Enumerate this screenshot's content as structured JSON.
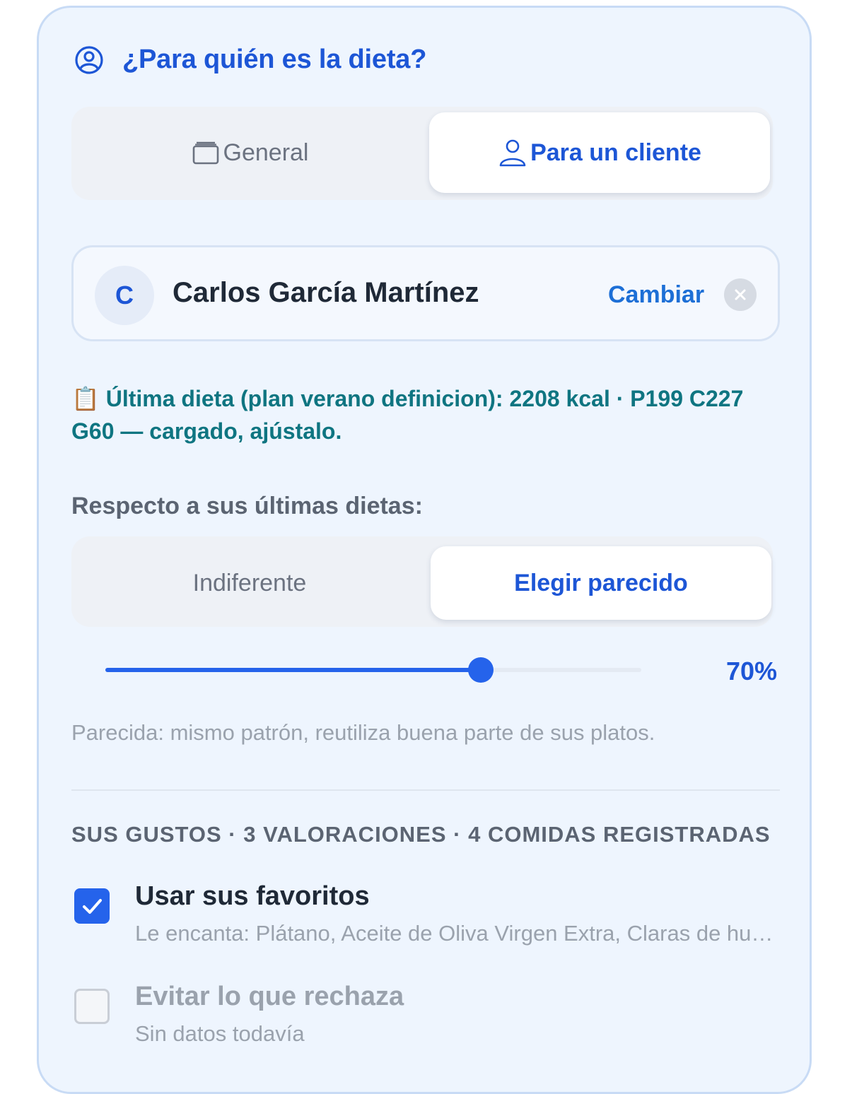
{
  "header": {
    "title": "¿Para quién es la dieta?",
    "icon": "user-circle-icon"
  },
  "target_selector": {
    "options": [
      {
        "label": "General",
        "icon": "stack-icon"
      },
      {
        "label": "Para un cliente",
        "icon": "user-icon"
      }
    ],
    "selected": "Para un cliente"
  },
  "client": {
    "initial": "C",
    "name": "Carlos García Martínez",
    "change_label": "Cambiar"
  },
  "last_diet": {
    "icon": "📋",
    "text": "Última dieta (plan verano definicion): 2208 kcal · P199 C227 G60 — cargado, ajústalo."
  },
  "similarity": {
    "label": "Respecto a sus últimas dietas:",
    "options": [
      "Indiferente",
      "Elegir parecido"
    ],
    "selected": "Elegir parecido",
    "value": 70,
    "value_label": "70%",
    "description": "Parecida: mismo patrón, reutiliza buena parte de sus platos."
  },
  "tastes": {
    "heading": "SUS GUSTOS · 3 VALORACIONES · 4 COMIDAS REGISTRADAS",
    "items": [
      {
        "title": "Usar sus favoritos",
        "subtitle": "Le encanta: Plátano, Aceite de Oliva Virgen Extra, Claras de huevo",
        "checked": true
      },
      {
        "title": "Evitar lo que rechaza",
        "subtitle": "Sin datos todavía",
        "checked": false
      }
    ]
  },
  "colors": {
    "accent": "#2563eb",
    "title_blue": "#1d56d6",
    "teal": "#0f7581",
    "card_bg": "#eef5fe"
  }
}
